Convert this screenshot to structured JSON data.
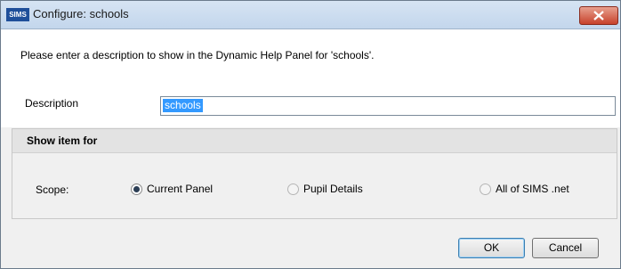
{
  "window": {
    "app_icon_text": "SIMS",
    "title": "Configure: schools"
  },
  "instructions": "Please enter a description to show in the Dynamic Help Panel for 'schools'.",
  "description": {
    "label": "Description",
    "value": "schools"
  },
  "show_item_for": {
    "heading": "Show item for",
    "scope_label": "Scope:",
    "options": [
      {
        "label": "Current Panel",
        "selected": true
      },
      {
        "label": "Pupil Details",
        "selected": false
      },
      {
        "label": "All of SIMS .net",
        "selected": false
      }
    ]
  },
  "buttons": {
    "ok": "OK",
    "cancel": "Cancel"
  }
}
